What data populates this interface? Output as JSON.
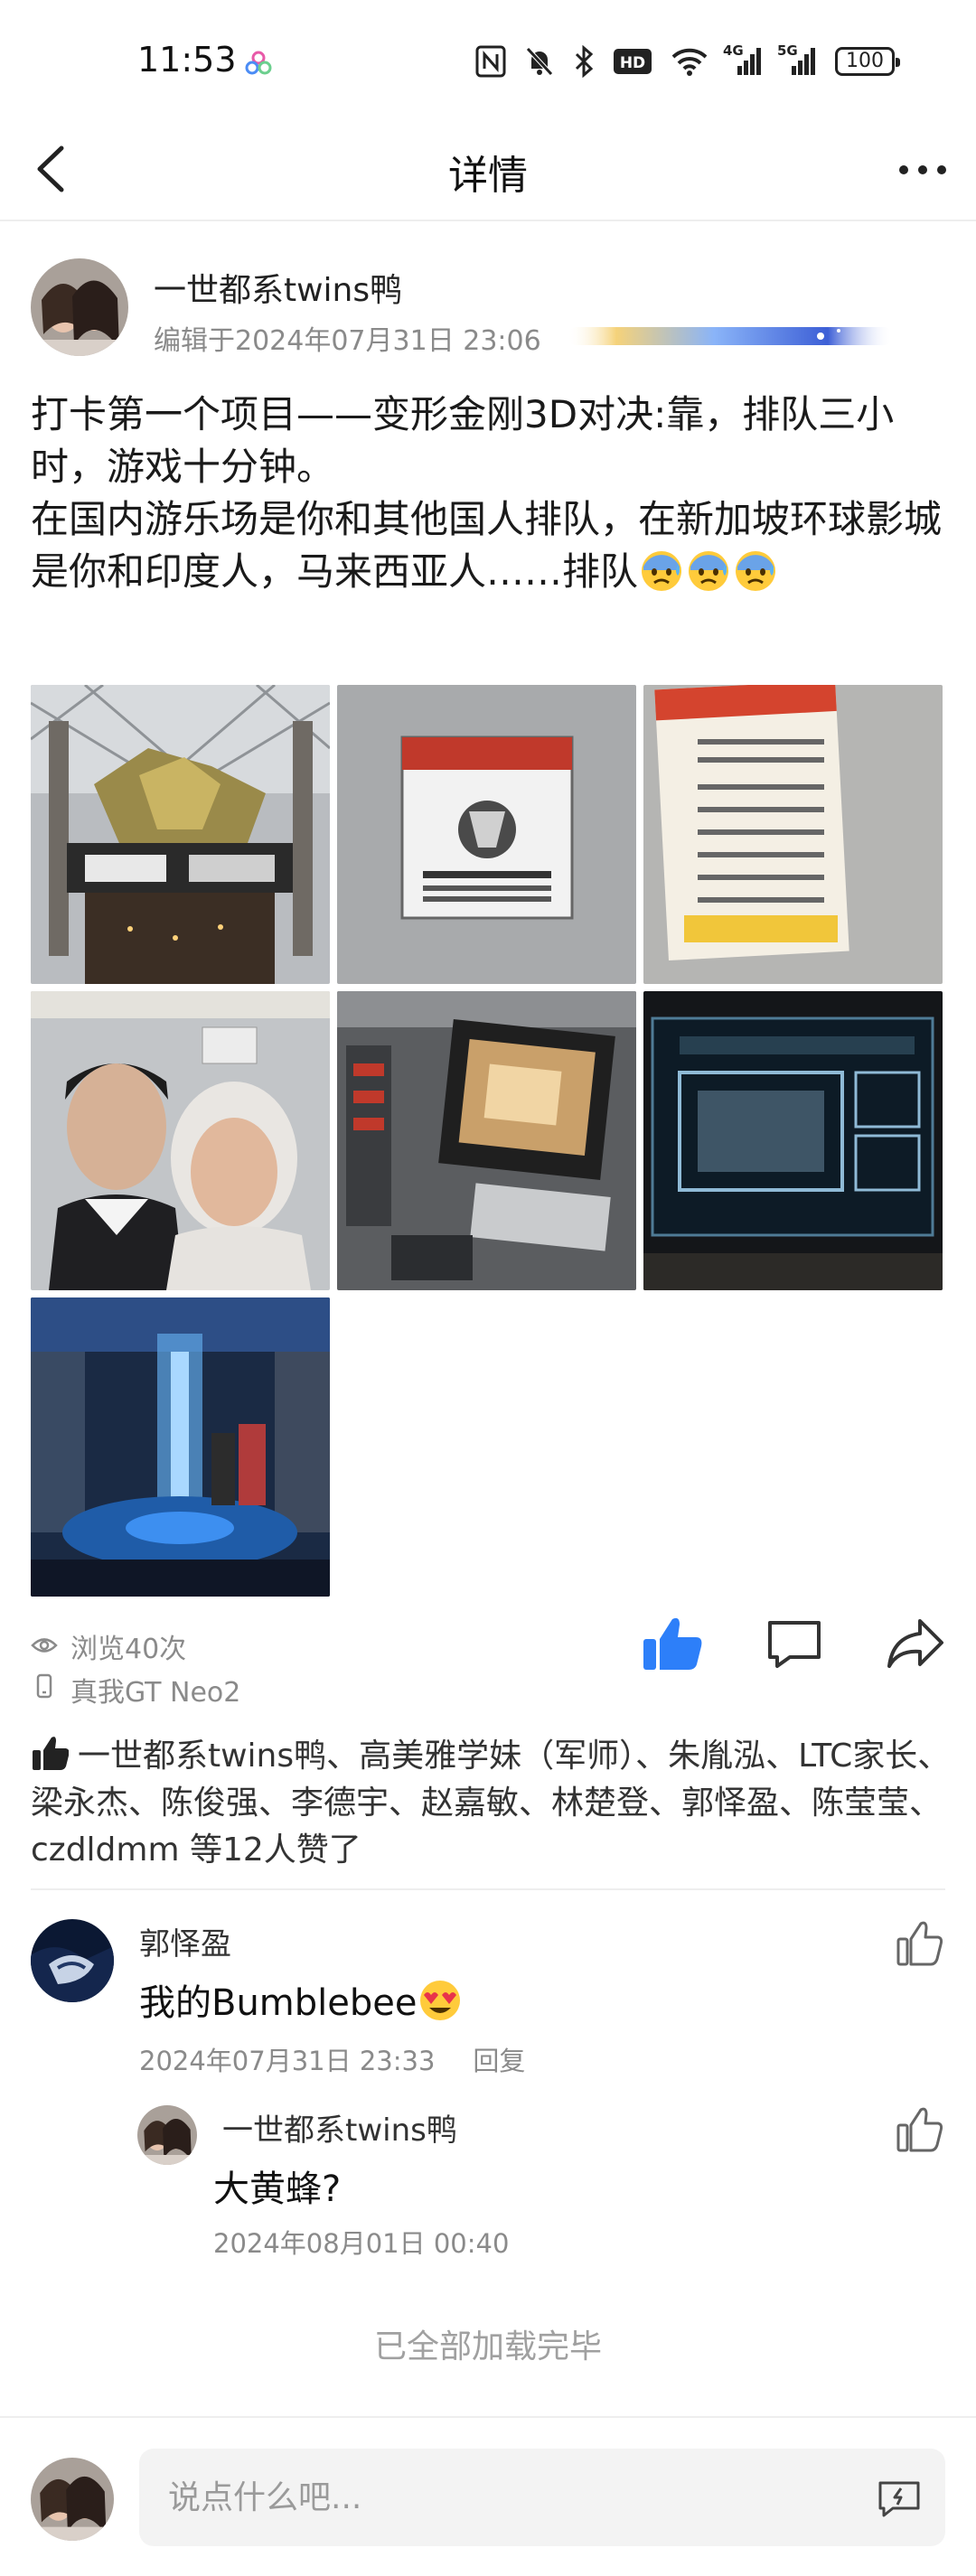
{
  "status_bar": {
    "time": "11:53",
    "network_4g": "4G",
    "network_5g": "5G",
    "battery": "100",
    "icons": [
      "app-notification-icon",
      "nfc-icon",
      "silent-bell-icon",
      "bluetooth-icon",
      "hd-icon",
      "wifi-icon",
      "signal-4g-icon",
      "signal-5g-icon",
      "battery-icon"
    ]
  },
  "nav": {
    "title": "详情",
    "back_icon": "chevron-left-icon",
    "more_icon": "more-dots-icon"
  },
  "post": {
    "author": "一世都系twins鸭",
    "edited_time": "编辑于2024年07月31日 23:06",
    "text_line1": "打卡第一个项目——变形金刚3D对决:靠，排队三小时，游戏十分钟。",
    "text_line2": "在国内游乐场是你和其他国人排队，在新加坡环球影城是你和印度人，马来西亚人……排队",
    "emoji": "anxious-sweat-face-emoji",
    "photos": [
      "transformers-ride-entrance-photo",
      "restricted-area-sign-photo",
      "warning-sign-photo",
      "selfie-two-people-photo",
      "control-panel-screen-photo",
      "monitor-screen-photo",
      "blue-lit-room-photo"
    ],
    "views": "浏览40次",
    "device": "真我GT Neo2",
    "likes_text": "一世都系twins鸭、高美雅学妹（军师）、朱胤泓、LTC家长、梁永杰、陈俊强、李德宇、赵嘉敏、林楚登、郭怿盈、陈莹莹、czdldmm 等12人赞了"
  },
  "comments": [
    {
      "author": "郭怿盈",
      "text": "我的Bumblebee",
      "emoji": "heart-eyes-emoji",
      "time": "2024年07月31日 23:33",
      "reply_label": "回复"
    }
  ],
  "replies": [
    {
      "author": "一世都系twins鸭",
      "text": "大黄蜂?",
      "time": "2024年08月01日 00:40"
    }
  ],
  "footer": {
    "all_loaded": "已全部加载完毕",
    "input_placeholder": "说点什么吧..."
  },
  "colors": {
    "accent_blue": "#2d7ff9",
    "text_gray": "#8a8a8a",
    "divider": "#eeeeee"
  }
}
